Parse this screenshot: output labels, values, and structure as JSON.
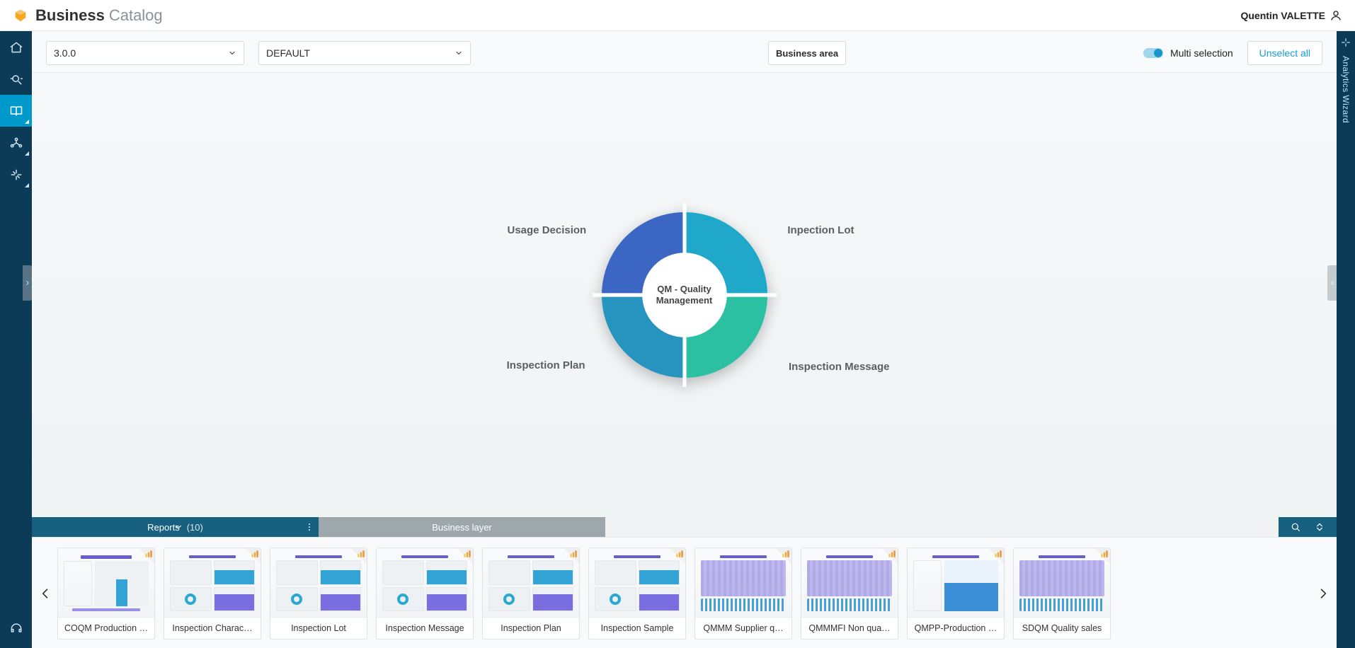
{
  "header": {
    "title": "Business",
    "subtitle": "Catalog",
    "user": "Quentin VALETTE"
  },
  "toolbar": {
    "version": "3.0.0",
    "profile": "DEFAULT",
    "scope": "Business area",
    "multi_label": "Multi selection",
    "unselect_label": "Unselect all"
  },
  "donut": {
    "center": "QM - Quality Management",
    "segments": {
      "tl": "Usage Decision",
      "tr": "Inpection Lot",
      "bl": "Inspection Plan",
      "br": "Inspection Message"
    }
  },
  "tabs": {
    "reports_label": "Reports",
    "reports_count": "(10)",
    "layer_label": "Business layer"
  },
  "rightbar": {
    "label": "Analytics Wizard"
  },
  "cards": [
    {
      "label": "COQM Production …"
    },
    {
      "label": "Inspection Charac…"
    },
    {
      "label": "Inspection Lot"
    },
    {
      "label": "Inspection Message"
    },
    {
      "label": "Inspection Plan"
    },
    {
      "label": "Inspection Sample"
    },
    {
      "label": "QMMM Supplier q…"
    },
    {
      "label": "QMMMFI Non qua…"
    },
    {
      "label": "QMPP-Production …"
    },
    {
      "label": "SDQM Quality sales"
    }
  ],
  "chart_data": {
    "type": "pie",
    "title": "QM - Quality Management",
    "series": [
      {
        "name": "Usage Decision",
        "value": 25,
        "color": "#3b66c4"
      },
      {
        "name": "Inpection Lot",
        "value": 25,
        "color": "#1fa8c9"
      },
      {
        "name": "Inspection Message",
        "value": 25,
        "color": "#2cc0a3"
      },
      {
        "name": "Inspection Plan",
        "value": 25,
        "color": "#2694bf"
      }
    ]
  }
}
